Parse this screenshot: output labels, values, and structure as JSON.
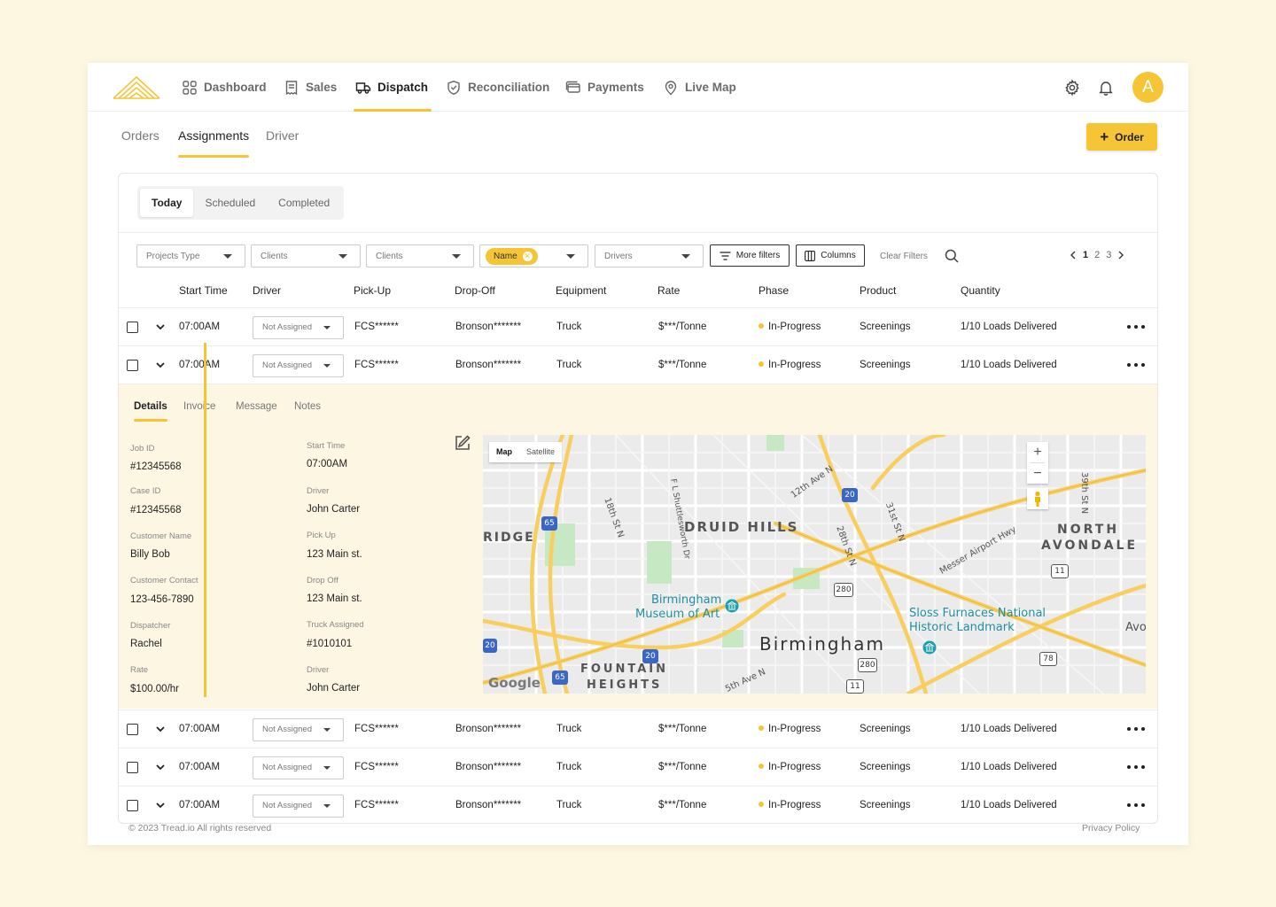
{
  "nav": {
    "items": [
      {
        "label": "Dashboard",
        "icon": "dashboard-icon"
      },
      {
        "label": "Sales",
        "icon": "receipt-icon"
      },
      {
        "label": "Dispatch",
        "icon": "truck-icon"
      },
      {
        "label": "Reconciliation",
        "icon": "shield-check-icon"
      },
      {
        "label": "Payments",
        "icon": "card-icon"
      },
      {
        "label": "Live Map",
        "icon": "location-pin-icon"
      }
    ],
    "active": "Dispatch",
    "avatar_letter": "A",
    "accent_color": "#f5c536"
  },
  "subtabs": [
    "Orders",
    "Assignments",
    "Driver"
  ],
  "order_button": "Order",
  "segments": [
    "Today",
    "Scheduled",
    "Completed"
  ],
  "filters": {
    "projects_type": "Projects Type",
    "clients_1": "Clients",
    "clients_2": "Clients",
    "name_chip": "Name",
    "drivers": "Drivers",
    "more_filters": "More filters",
    "columns": "Columns",
    "clear_filters": "Clear Filters"
  },
  "pagination": {
    "pages": [
      "1",
      "2",
      "3"
    ],
    "current": "1"
  },
  "table": {
    "headers": [
      "Start Time",
      "Driver",
      "Pick-Up",
      "Drop-Off",
      "Equipment",
      "Rate",
      "Phase",
      "Product",
      "Quantity"
    ],
    "rows": [
      {
        "start": "07:00AM",
        "driver": "Not Assigned",
        "pickup": "FCS******",
        "dropoff": "Bronson*******",
        "equipment": "Truck",
        "rate": "$***/Tonne",
        "phase": "In-Progress",
        "product": "Screenings",
        "quantity": "1/10 Loads Delivered"
      },
      {
        "start": "07:00AM",
        "driver": "Not Assigned",
        "pickup": "FCS******",
        "dropoff": "Bronson*******",
        "equipment": "Truck",
        "rate": "$***/Tonne",
        "phase": "In-Progress",
        "product": "Screenings",
        "quantity": "1/10 Loads Delivered"
      },
      {
        "start": "07:00AM",
        "driver": "Not Assigned",
        "pickup": "FCS******",
        "dropoff": "Bronson*******",
        "equipment": "Truck",
        "rate": "$***/Tonne",
        "phase": "In-Progress",
        "product": "Screenings",
        "quantity": "1/10 Loads Delivered"
      },
      {
        "start": "07:00AM",
        "driver": "Not Assigned",
        "pickup": "FCS******",
        "dropoff": "Bronson*******",
        "equipment": "Truck",
        "rate": "$***/Tonne",
        "phase": "In-Progress",
        "product": "Screenings",
        "quantity": "1/10 Loads Delivered"
      },
      {
        "start": "07:00AM",
        "driver": "Not Assigned",
        "pickup": "FCS******",
        "dropoff": "Bronson*******",
        "equipment": "Truck",
        "rate": "$***/Tonne",
        "phase": "In-Progress",
        "product": "Screenings",
        "quantity": "1/10 Loads Delivered"
      }
    ]
  },
  "details": {
    "tabs": [
      "Details",
      "Invoice",
      "Message",
      "Notes"
    ],
    "left": [
      {
        "label": "Job ID",
        "value": "#12345568"
      },
      {
        "label": "Case ID",
        "value": "#12345568"
      },
      {
        "label": "Customer Name",
        "value": "Billy Bob"
      },
      {
        "label": "Customer Contact",
        "value": "123-456-7890"
      },
      {
        "label": "Dispatcher",
        "value": "Rachel"
      },
      {
        "label": "Rate",
        "value": "$100.00/hr"
      }
    ],
    "right": [
      {
        "label": "Start Time",
        "value": "07:00AM"
      },
      {
        "label": "Driver",
        "value": "John Carter"
      },
      {
        "label": "Pick Up",
        "value": "123 Main st."
      },
      {
        "label": "Drop Off",
        "value": "123 Main st."
      },
      {
        "label": "Truck Assigned",
        "value": "#1010101"
      },
      {
        "label": "Driver",
        "value": "John Carter"
      }
    ]
  },
  "map": {
    "toggle": [
      "Map",
      "Satellite"
    ],
    "labels": {
      "druid_hills": "DRUID HILLS",
      "north_avondale_1": "NORTH",
      "north_avondale_2": "AVONDALE",
      "ridge": "RIDGE",
      "museum_1": "Birmingham",
      "museum_2": "Museum of Art",
      "birmingham": "Birmingham",
      "sloss_1": "Sloss Furnaces National",
      "sloss_2": "Historic Landmark",
      "fountain_1": "FOUNTAIN",
      "fountain_2": "HEIGHTS",
      "ave_12": "12th Ave N",
      "st_18": "18th St N",
      "shuttlesworth": "F L Shuttlesworth Dr",
      "st_28": "28th St N",
      "st_31": "31st St N",
      "messer": "Messer Airport Hwy",
      "st_39": "39th St N",
      "ave_5": "5th Ave N",
      "avo": "Avo",
      "google": "Google"
    },
    "shields": [
      "65",
      "20",
      "280",
      "20",
      "20",
      "65",
      "280",
      "11",
      "11",
      "78"
    ]
  },
  "footer": {
    "copyright": "© 2023 Tread.io All rights reserved",
    "privacy": "Privacy Policy"
  }
}
